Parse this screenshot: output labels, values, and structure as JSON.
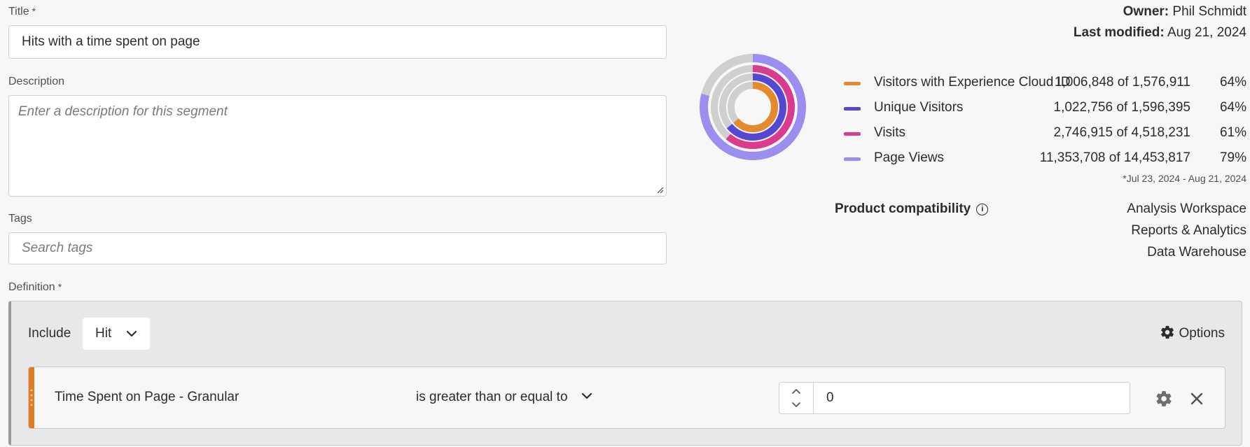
{
  "form": {
    "title_label": "Title",
    "title_value": "Hits with a time spent on page",
    "description_label": "Description",
    "description_placeholder": "Enter a description for this segment",
    "tags_label": "Tags",
    "tags_placeholder": "Search tags",
    "definition_label": "Definition",
    "required_marker": "*"
  },
  "meta": {
    "owner_label": "Owner:",
    "owner_value": "Phil Schmidt",
    "modified_label": "Last modified:",
    "modified_value": "Aug 21, 2024"
  },
  "summary": {
    "items": [
      {
        "name": "Visitors with Experience Cloud ID",
        "count": "1,006,848",
        "of": "of",
        "total": "1,576,911",
        "pct": "64%",
        "color": "#e68a2e",
        "fraction": 0.64
      },
      {
        "name": "Unique Visitors",
        "count": "1,022,756",
        "of": "of",
        "total": "1,596,395",
        "pct": "64%",
        "color": "#5647d0",
        "fraction": 0.64
      },
      {
        "name": "Visits",
        "count": "2,746,915",
        "of": "of",
        "total": "4,518,231",
        "pct": "61%",
        "color": "#da3b8e",
        "fraction": 0.61
      },
      {
        "name": "Page Views",
        "count": "11,353,708",
        "of": "of",
        "total": "14,453,817",
        "pct": "79%",
        "color": "#9b8ef0",
        "fraction": 0.79
      }
    ],
    "date_range": "*Jul 23, 2024 - Aug 21, 2024",
    "ring_background": "#cfcfcf"
  },
  "compatibility": {
    "title": "Product compatibility",
    "info_glyph": "i",
    "products": [
      "Analysis Workspace",
      "Reports & Analytics",
      "Data Warehouse"
    ]
  },
  "definition": {
    "include_label": "Include",
    "container_value": "Hit",
    "options_label": "Options",
    "rule": {
      "dimension": "Time Spent on Page - Granular",
      "operator": "is greater than or equal to",
      "value": "0",
      "accent_color": "#e07b22"
    }
  }
}
